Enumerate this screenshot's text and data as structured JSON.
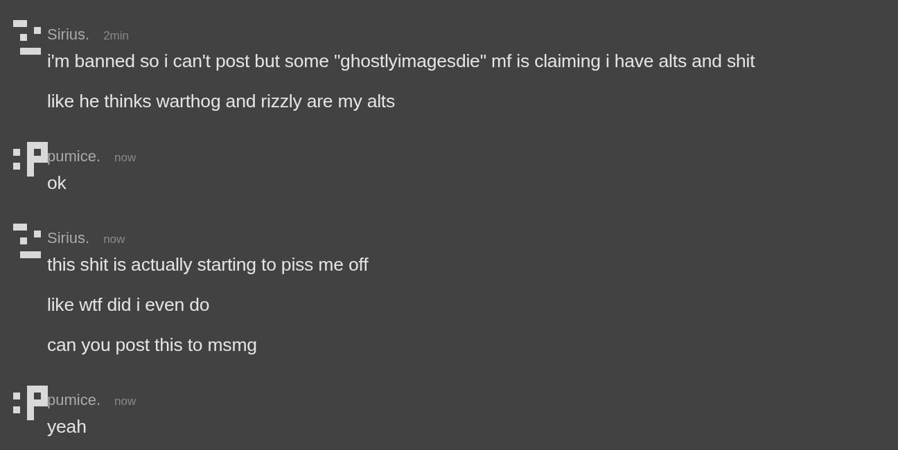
{
  "messages": [
    {
      "author": "Sirius.",
      "time": "2min",
      "avatar": {
        "kind": "bars"
      },
      "lines": [
        "i'm banned so i can't post but some \"ghostlyimagesdie\" mf is claiming i have alts and shit",
        "like he thinks warthog and rizzly are my alts"
      ]
    },
    {
      "author": "pumice.",
      "time": "now",
      "avatar": {
        "kind": "block"
      },
      "lines": [
        "ok"
      ]
    },
    {
      "author": "Sirius.",
      "time": "now",
      "avatar": {
        "kind": "bars"
      },
      "lines": [
        "this shit is actually starting to piss me off",
        "like wtf did i even do",
        "can you post this to msmg"
      ]
    },
    {
      "author": "pumice.",
      "time": "now",
      "avatar": {
        "kind": "block"
      },
      "lines": [
        "yeah"
      ]
    }
  ]
}
